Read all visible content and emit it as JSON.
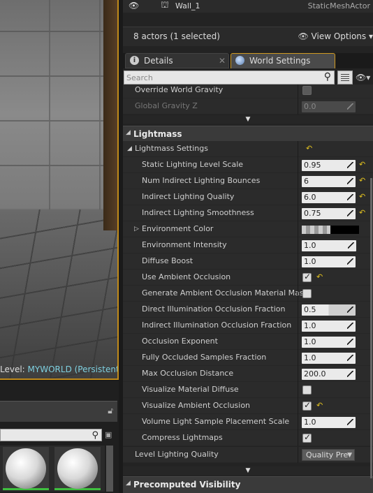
{
  "viewport": {
    "level_prefix": "Level: ",
    "level_name": "MYWORLD (Persistent)"
  },
  "outliner": {
    "row_name": "Wall_1",
    "row_type": "StaticMeshActor",
    "actor_count": "8 actors (1 selected)",
    "view_options": "View Options"
  },
  "tabs": {
    "details": "Details",
    "world_settings": "World Settings"
  },
  "search": {
    "placeholder": "Search"
  },
  "physics": {
    "override_gravity": "Override World Gravity",
    "global_gravity_z": "Global Gravity Z",
    "global_gravity_z_value": "0.0"
  },
  "lightmass": {
    "section_title": "Lightmass",
    "group_title": "Lightmass Settings",
    "props": [
      {
        "label": "Static Lighting Level Scale",
        "value": "0.95"
      },
      {
        "label": "Num Indirect Lighting Bounces",
        "value": "6"
      },
      {
        "label": "Indirect Lighting Quality",
        "value": "6.0"
      },
      {
        "label": "Indirect Lighting Smoothness",
        "value": "0.75"
      },
      {
        "label": "Environment Color",
        "value": ""
      },
      {
        "label": "Environment Intensity",
        "value": "1.0"
      },
      {
        "label": "Diffuse Boost",
        "value": "1.0"
      },
      {
        "label": "Use Ambient Occlusion",
        "value": ""
      },
      {
        "label": "Generate Ambient Occlusion Material Mask",
        "value": ""
      },
      {
        "label": "Direct Illumination Occlusion Fraction",
        "value": "0.5"
      },
      {
        "label": "Indirect Illumination Occlusion Fraction",
        "value": "1.0"
      },
      {
        "label": "Occlusion Exponent",
        "value": "1.0"
      },
      {
        "label": "Fully Occluded Samples Fraction",
        "value": "1.0"
      },
      {
        "label": "Max Occlusion Distance",
        "value": "200.0"
      },
      {
        "label": "Visualize Material Diffuse",
        "value": ""
      },
      {
        "label": "Visualize Ambient Occlusion",
        "value": ""
      },
      {
        "label": "Volume Light Sample Placement Scale",
        "value": "1.0"
      },
      {
        "label": "Compress Lightmaps",
        "value": ""
      }
    ],
    "level_lighting_quality_label": "Level Lighting Quality",
    "level_lighting_quality_value": "Quality Pre"
  },
  "precomputed": {
    "section_title": "Precomputed Visibility"
  },
  "colors": {
    "accent": "#c08a1a",
    "reset_arrow": "#e0c020",
    "level_name": "#7fd0e0",
    "asset_bar": "#3fbf3f"
  },
  "icons": {
    "visibility": "eye-icon",
    "mesh": "static-mesh-icon",
    "details": "info-icon",
    "world": "globe-icon",
    "search": "search-icon",
    "lock": "lock-icon",
    "save": "save-icon"
  }
}
